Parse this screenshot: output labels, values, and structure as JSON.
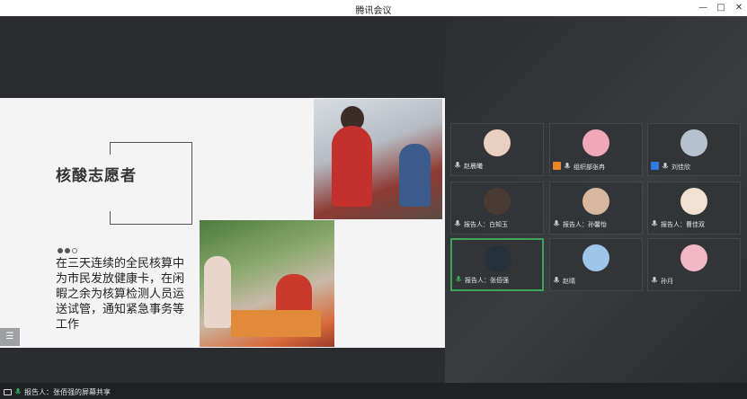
{
  "window": {
    "title": "腾讯会议",
    "minimize_label": "—",
    "maximize_label": "□",
    "close_label": "✕"
  },
  "slide": {
    "title": "核酸志愿者",
    "body": "在三天连续的全民核算中为市民发放健康卡，在闲暇之余为核算检测人员运送试管，通知紧急事务等工作",
    "menu_label": "☰"
  },
  "participants": [
    {
      "name": "赵晨曦",
      "prefix": "",
      "role": "none",
      "avatar_color": "#e9cfc0"
    },
    {
      "name": "组织部张冉",
      "prefix": "",
      "role": "organizer",
      "avatar_color": "#f0a8b8"
    },
    {
      "name": "刘佳欣",
      "prefix": "",
      "role": "host",
      "avatar_color": "#b7c2cf"
    },
    {
      "name": "白知玉",
      "prefix": "报告人：",
      "role": "none",
      "avatar_color": "#4a3a34"
    },
    {
      "name": "孙馨怡",
      "prefix": "报告人：",
      "role": "none",
      "avatar_color": "#d9b8a0"
    },
    {
      "name": "曹佳双",
      "prefix": "报告人：",
      "role": "none",
      "avatar_color": "#efe2d2"
    },
    {
      "name": "张佰强",
      "prefix": "报告人：",
      "role": "none",
      "avatar_color": "#24303a"
    },
    {
      "name": "赵晴",
      "prefix": "",
      "role": "none",
      "avatar_color": "#9ec6ea"
    },
    {
      "name": "孙月",
      "prefix": "",
      "role": "none",
      "avatar_color": "#f2b7c4"
    }
  ],
  "status_bar": {
    "screen_share_text": "报告人：张佰强的屏幕共享"
  },
  "colors": {
    "active_speaker_border": "#3aa85a",
    "tile_background": "#323438",
    "organizer_icon": "#e8872a",
    "host_icon": "#2f7de0"
  }
}
